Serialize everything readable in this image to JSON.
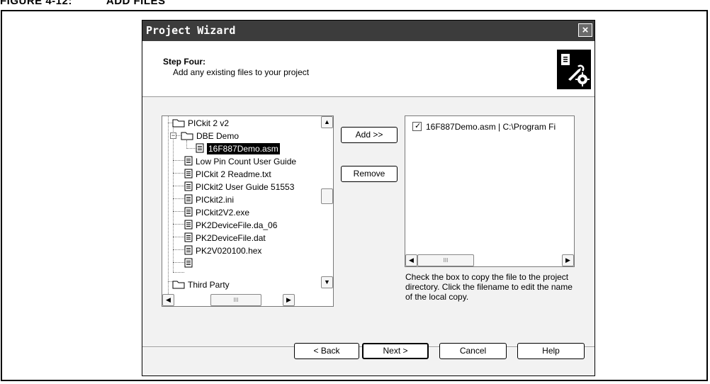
{
  "figure": {
    "label": "FIGURE 4-12:",
    "title": "ADD FILES"
  },
  "dialog": {
    "title": "Project Wizard",
    "close_label": "×",
    "step_title": "Step Four:",
    "step_description": "Add any existing files to your project"
  },
  "tree": {
    "items": [
      {
        "label": "PICkit 2 v2",
        "type": "folder"
      },
      {
        "label": "DBE Demo",
        "type": "folder"
      },
      {
        "label": "16F887Demo.asm",
        "type": "file",
        "selected": true
      },
      {
        "label": "Low Pin Count User Guide",
        "type": "file"
      },
      {
        "label": "PICkit 2 Readme.txt",
        "type": "file"
      },
      {
        "label": "PICkit2 User Guide 51553",
        "type": "file"
      },
      {
        "label": "PICkit2.ini",
        "type": "file"
      },
      {
        "label": "PICkit2V2.exe",
        "type": "file"
      },
      {
        "label": "PK2DeviceFile.da_06",
        "type": "file"
      },
      {
        "label": "PK2DeviceFile.dat",
        "type": "file"
      },
      {
        "label": "PK2V020100.hex",
        "type": "file"
      },
      {
        "label": "Third Party",
        "type": "folder"
      }
    ],
    "thumb_grip": "III"
  },
  "buttons": {
    "add": "Add >>",
    "remove": "Remove",
    "back": "< Back",
    "next": "Next >",
    "cancel": "Cancel",
    "help": "Help"
  },
  "project_files": {
    "items": [
      {
        "label": "16F887Demo.asm | C:\\Program Fi",
        "checked": true
      }
    ]
  },
  "hint_text": "Check the box to copy the file to the project directory.  Click the filename to edit the name of the local copy.",
  "icons": {
    "folder": "folder-icon",
    "file": "document-icon",
    "wizard": "wizard-tools-icon"
  },
  "colors": {
    "titlebar": "#3c3c3c",
    "dialog_bg": "#f2f2f2",
    "selection": "#000000"
  }
}
